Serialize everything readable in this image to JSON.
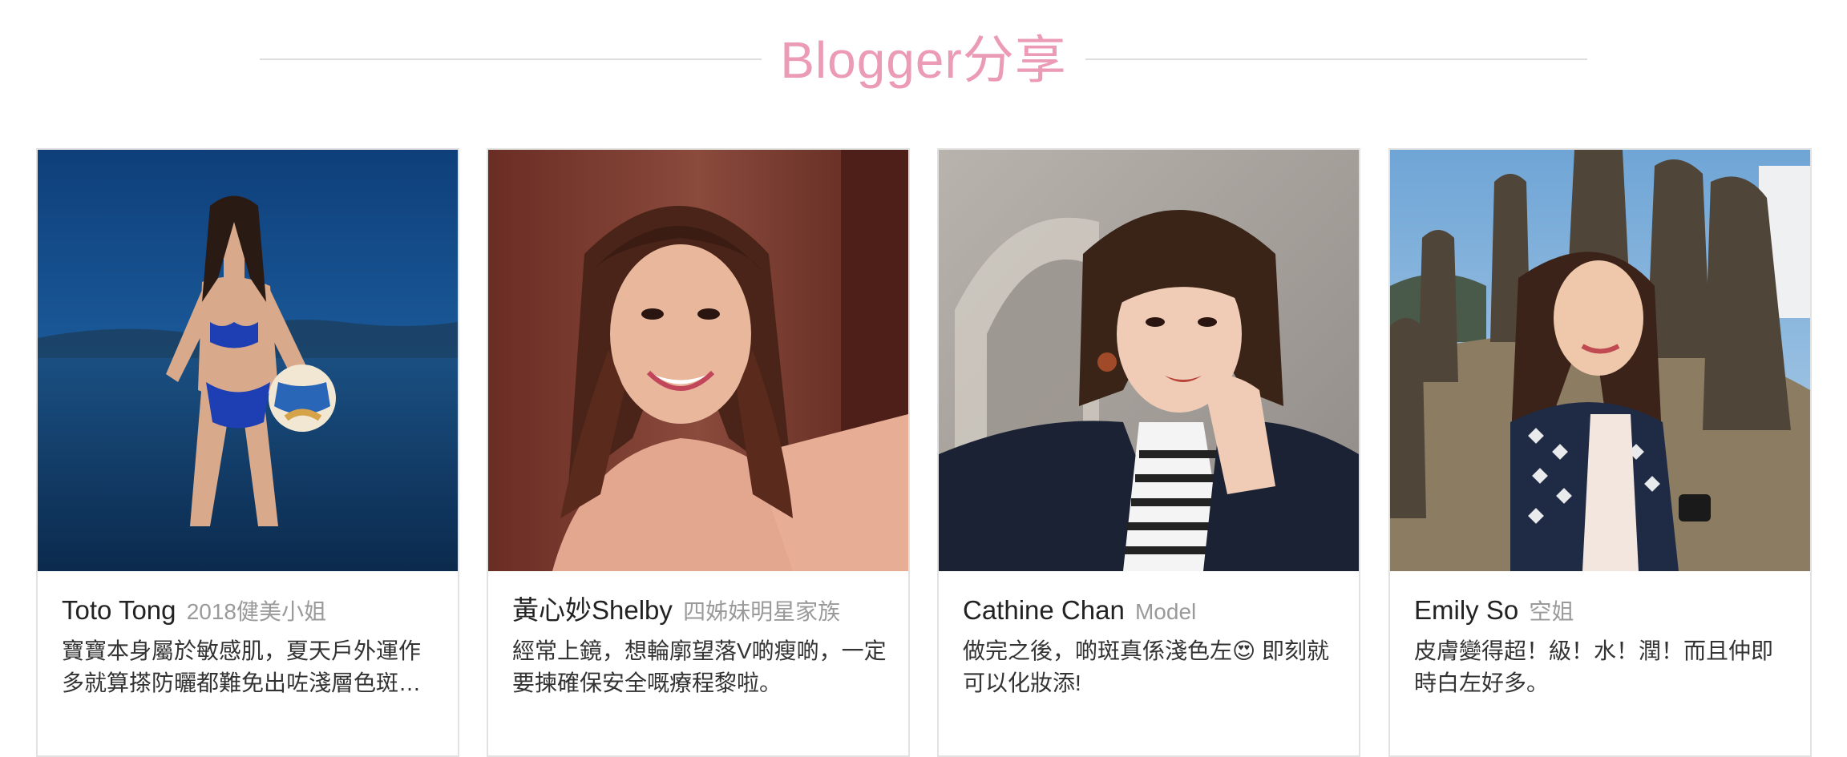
{
  "section": {
    "title": "Blogger分享"
  },
  "cards": [
    {
      "name": "Toto Tong",
      "role": "2018健美小姐",
      "description": "寶寶本身屬於敏感肌，夏天戶外運作多就算搽防曬都難免出咗淺層色斑…",
      "image_icon": "beach-portrait-photo"
    },
    {
      "name": "黃心妙Shelby",
      "role": "四姊妹明星家族",
      "description": "經常上鏡，想輪廓望落V啲瘦啲，一定要揀確保安全嘅療程黎啦。",
      "image_icon": "selfie-portrait-photo"
    },
    {
      "name": "Cathine Chan",
      "role": "Model",
      "description": "做完之後，啲斑真係淺色左😍 即刻就可以化妝添!",
      "image_icon": "studio-portrait-photo"
    },
    {
      "name": "Emily So",
      "role": "空姐",
      "description": "皮膚變得超！級！水！潤！而且仲即時白左好多。",
      "image_icon": "travel-portrait-photo"
    }
  ],
  "colors": {
    "title": "#ec9bb7",
    "divider": "#dddddd",
    "card_border": "#e2e2e2",
    "name_text": "#222222",
    "role_text": "#9a9a9a"
  }
}
